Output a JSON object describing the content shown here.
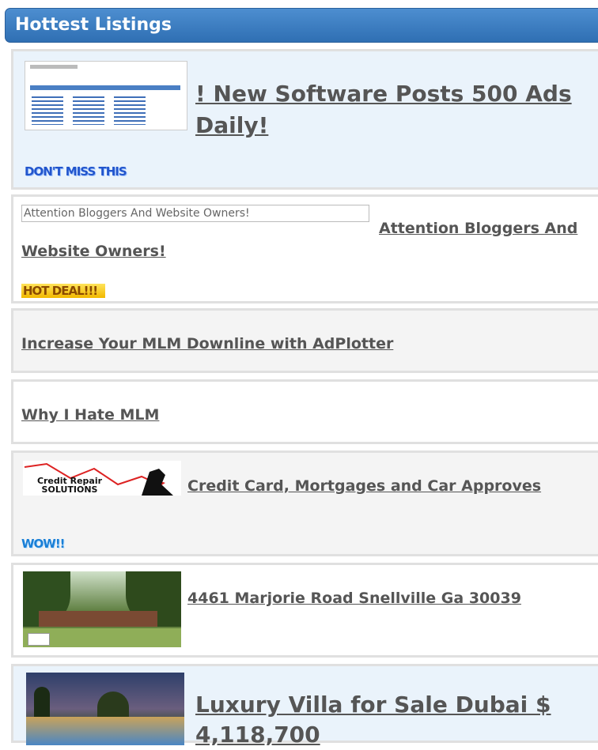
{
  "header": {
    "title": "Hottest Listings"
  },
  "listings": [
    {
      "title": "! New Software Posts 500 Ads Daily!",
      "badge": "DON'T MISS THIS"
    },
    {
      "alt_text": "Attention Bloggers And Website Owners!",
      "title": "Attention Bloggers And Website Owners!",
      "badge": "HOT DEAL!!!"
    },
    {
      "title": "Increase Your MLM Downline with AdPlotter"
    },
    {
      "title": "Why I Hate MLM"
    },
    {
      "image_text": "Credit Repair SOLUTIONS",
      "title": "Credit Card, Mortgages and Car Approves",
      "badge": "WOW!!"
    },
    {
      "title": "4461 Marjorie Road Snellville Ga 30039"
    },
    {
      "title": "Luxury Villa for Sale Dubai $ 4,118,700"
    }
  ],
  "colors": {
    "header": "#3b7dc0",
    "link": "#555555",
    "badge_blue": "#2255cc",
    "badge_yellow": "#f2c200"
  }
}
